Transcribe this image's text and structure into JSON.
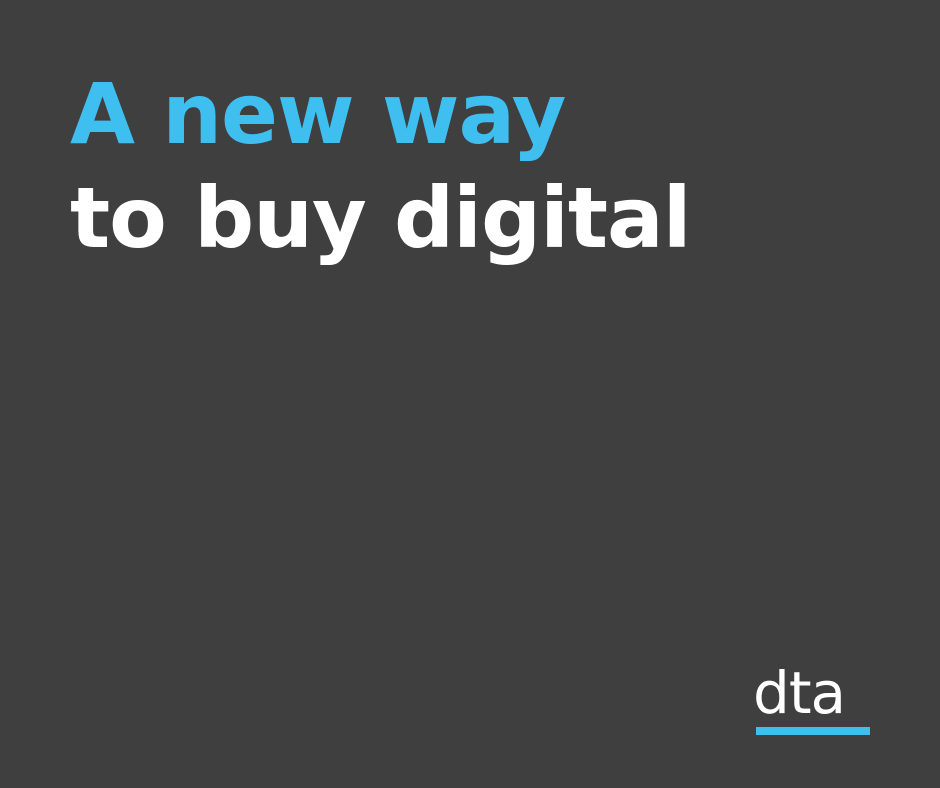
{
  "headline": {
    "line1": "A new way",
    "line2": "to buy digital"
  },
  "logo": {
    "text": "dta"
  },
  "colors": {
    "background": "#3f3f40",
    "accent": "#3fbff0",
    "text": "#ffffff"
  }
}
